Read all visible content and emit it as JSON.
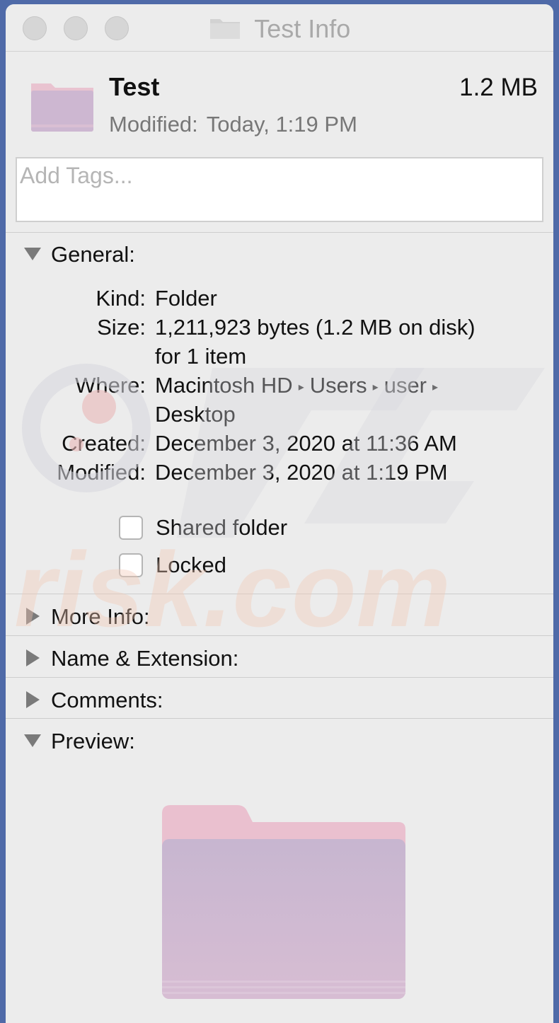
{
  "window": {
    "title": "Test Info"
  },
  "header": {
    "name": "Test",
    "size": "1.2 MB",
    "modified_label": "Modified:",
    "modified_value": "Today, 1:19 PM"
  },
  "tags": {
    "placeholder": "Add Tags..."
  },
  "general": {
    "title": "General:",
    "kind_label": "Kind:",
    "kind_value": "Folder",
    "size_label": "Size:",
    "size_value_line1": "1,211,923 bytes (1.2 MB on disk)",
    "size_value_line2": "for 1 item",
    "where_label": "Where:",
    "where_path": [
      "Macintosh HD",
      "Users",
      "user"
    ],
    "where_path_last": "Desktop",
    "created_label": "Created:",
    "created_value": "December 3, 2020 at 11:36 AM",
    "modified_label": "Modified:",
    "modified_value": "December 3, 2020 at 1:19 PM",
    "shared_folder_label": "Shared folder",
    "shared_folder_checked": false,
    "locked_label": "Locked",
    "locked_checked": false
  },
  "sections": {
    "more_info": "More Info:",
    "name_extension": "Name & Extension:",
    "comments": "Comments:",
    "preview": "Preview:"
  },
  "watermark": {
    "text": "risk.com"
  },
  "colors": {
    "window_bg": "#ececec",
    "desktop_bg": "#4f6aa8",
    "folder_top": "#e8bccb",
    "folder_body": "#c9b4cf",
    "disclosure": "#7a7a7a"
  },
  "icons": {
    "title_folder": "folder-icon",
    "header_folder": "folder-icon",
    "preview_folder": "folder-icon",
    "path_separator": "▸"
  }
}
